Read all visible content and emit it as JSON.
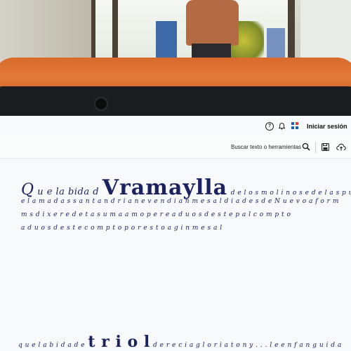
{
  "topbar": {
    "help_icon": "?",
    "signin_label": "Iniciar sesión"
  },
  "toolbar": {
    "search_label": "Buscar texto o herramientas"
  },
  "manuscript": {
    "line1_initial": "Q",
    "line1_pre": "u e la bida d",
    "line1_big": "Vramaylla",
    "line1_post": "d e l o s m o l i n o s e d e l a s p u e n",
    "line2": "e l a m a d a s  s a n t a n d r i a n  e  v e n d i a n  m e s a l  d i a d e s  d e  N u e v o  a f o r m",
    "line3": "m s  d i x e r e  d e t a  s u m a  a m o  p e r e  a  d u o s  d e s t e  p a l  c o m p t o",
    "line4": "a  d u o s  d e s t e  c o m p t o   p o r e s t o a g i n  m e s a l",
    "line5_pre": "q u e  l a  b i d a  d e",
    "line5_big": "t r i o l",
    "line5_post": "d e  r e c i a  g l o r i a  t o n y  . . .  l e  e n f a n g u i d a"
  }
}
